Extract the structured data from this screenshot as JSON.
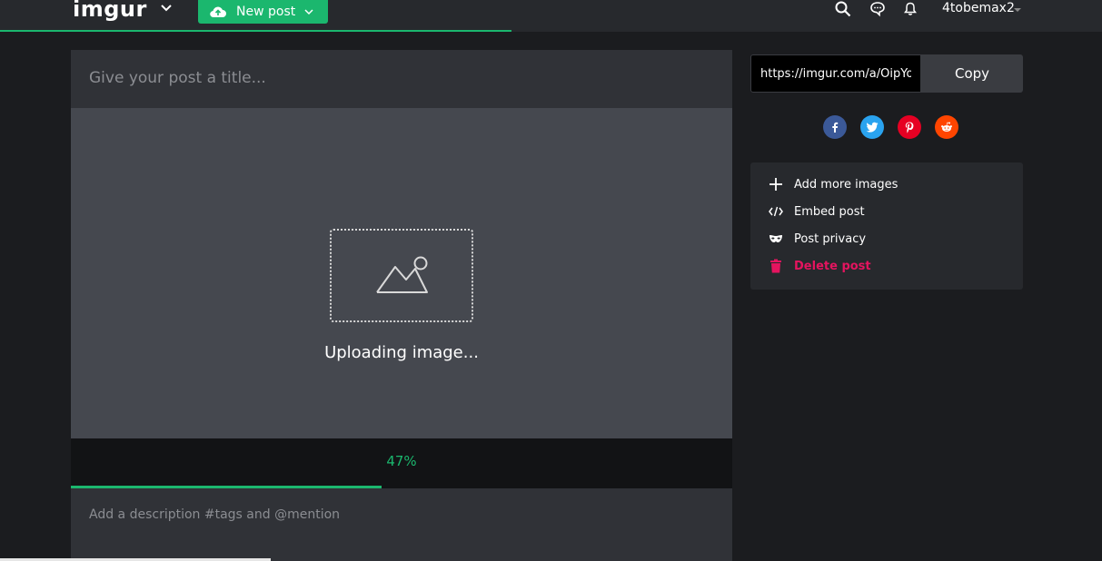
{
  "header": {
    "logo": "imgur",
    "new_post_label": "New post",
    "username": "4tobemax2"
  },
  "editor": {
    "title_placeholder": "Give your post a title...",
    "upload_status": "Uploading image...",
    "progress_text": "47%",
    "progress_value": 0.47,
    "description_placeholder": "Add a description #tags and @mention"
  },
  "share": {
    "link_value": "https://imgur.com/a/OipYo",
    "copy_label": "Copy",
    "networks": [
      "facebook",
      "twitter",
      "pinterest",
      "reddit"
    ]
  },
  "actions": [
    {
      "label": "Add more images"
    },
    {
      "label": "Embed post"
    },
    {
      "label": "Post privacy"
    },
    {
      "label": "Delete post"
    }
  ],
  "colors": {
    "accent": "#1bb76e",
    "danger": "#e5145f",
    "facebook": "#3b5998",
    "twitter": "#2aa3ef",
    "pinterest": "#e60023",
    "reddit": "#ff4500"
  }
}
